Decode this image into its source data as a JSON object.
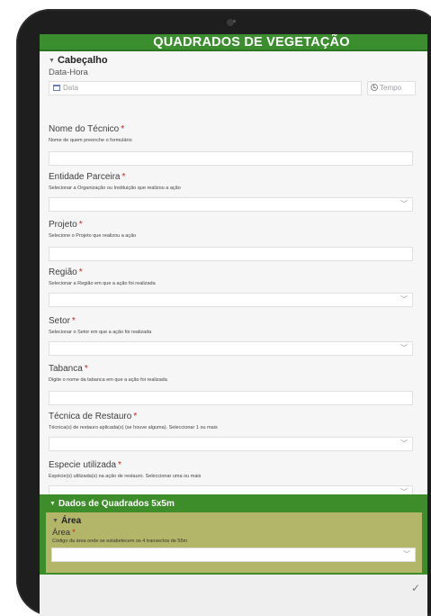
{
  "app": {
    "title": "QUADRADOS DE VEGETAÇÃO"
  },
  "cabecalho": {
    "header": "Cabeçalho",
    "datetime": {
      "label": "Data-Hora",
      "date_placeholder": "Data",
      "time_placeholder": "Tempo"
    },
    "fields": [
      {
        "label": "Nome do Técnico",
        "hint": "Nome de quem preenche o formulário",
        "type": "text",
        "value": ""
      },
      {
        "label": "Entidade Parceira",
        "hint": "Selecionar a Organização ou Instituição que realizou a ação",
        "type": "select",
        "value": ""
      },
      {
        "label": "Projeto",
        "hint": "Selecione o Projeto que realizou a ação",
        "type": "text",
        "value": ""
      },
      {
        "label": "Região",
        "hint": "Selecionar a Região em que a ação foi realizada",
        "type": "select",
        "value": ""
      },
      {
        "label": "Setor",
        "hint": "Selecionar o Setor em que a ação foi realizada",
        "type": "select",
        "value": ""
      },
      {
        "label": "Tabanca",
        "hint": "Digite o nome da tabanca em que a ação foi realizada",
        "type": "text",
        "value": ""
      },
      {
        "label": "Técnica de Restauro",
        "hint": "Técnica(s) de restauro aplicada(s) (se houve alguma). Seleccionar 1 ou mais",
        "type": "select",
        "value": ""
      },
      {
        "label": "Especie utilizada",
        "hint": "Espécie(s) utilizada(s) na ação de restauro. Seleccionar uma ou mais",
        "type": "select",
        "value": ""
      }
    ]
  },
  "dados": {
    "header": "Dados de Quadrados 5x5m",
    "area": {
      "header": "Área",
      "label": "Área",
      "hint": "Código da área onde se estabelecem os 4 transectos de 55m",
      "value": ""
    }
  },
  "icons": {
    "date": "calendar-icon",
    "time": "clock-icon",
    "collapse": "caret-down-icon",
    "select": "chevron-down-icon",
    "submit": "checkmark-icon"
  },
  "colors": {
    "title_bar": "#3a8e2d",
    "section_green": "#3d8d2b",
    "area_olive": "#b3b668",
    "required": "#d21f1f"
  }
}
